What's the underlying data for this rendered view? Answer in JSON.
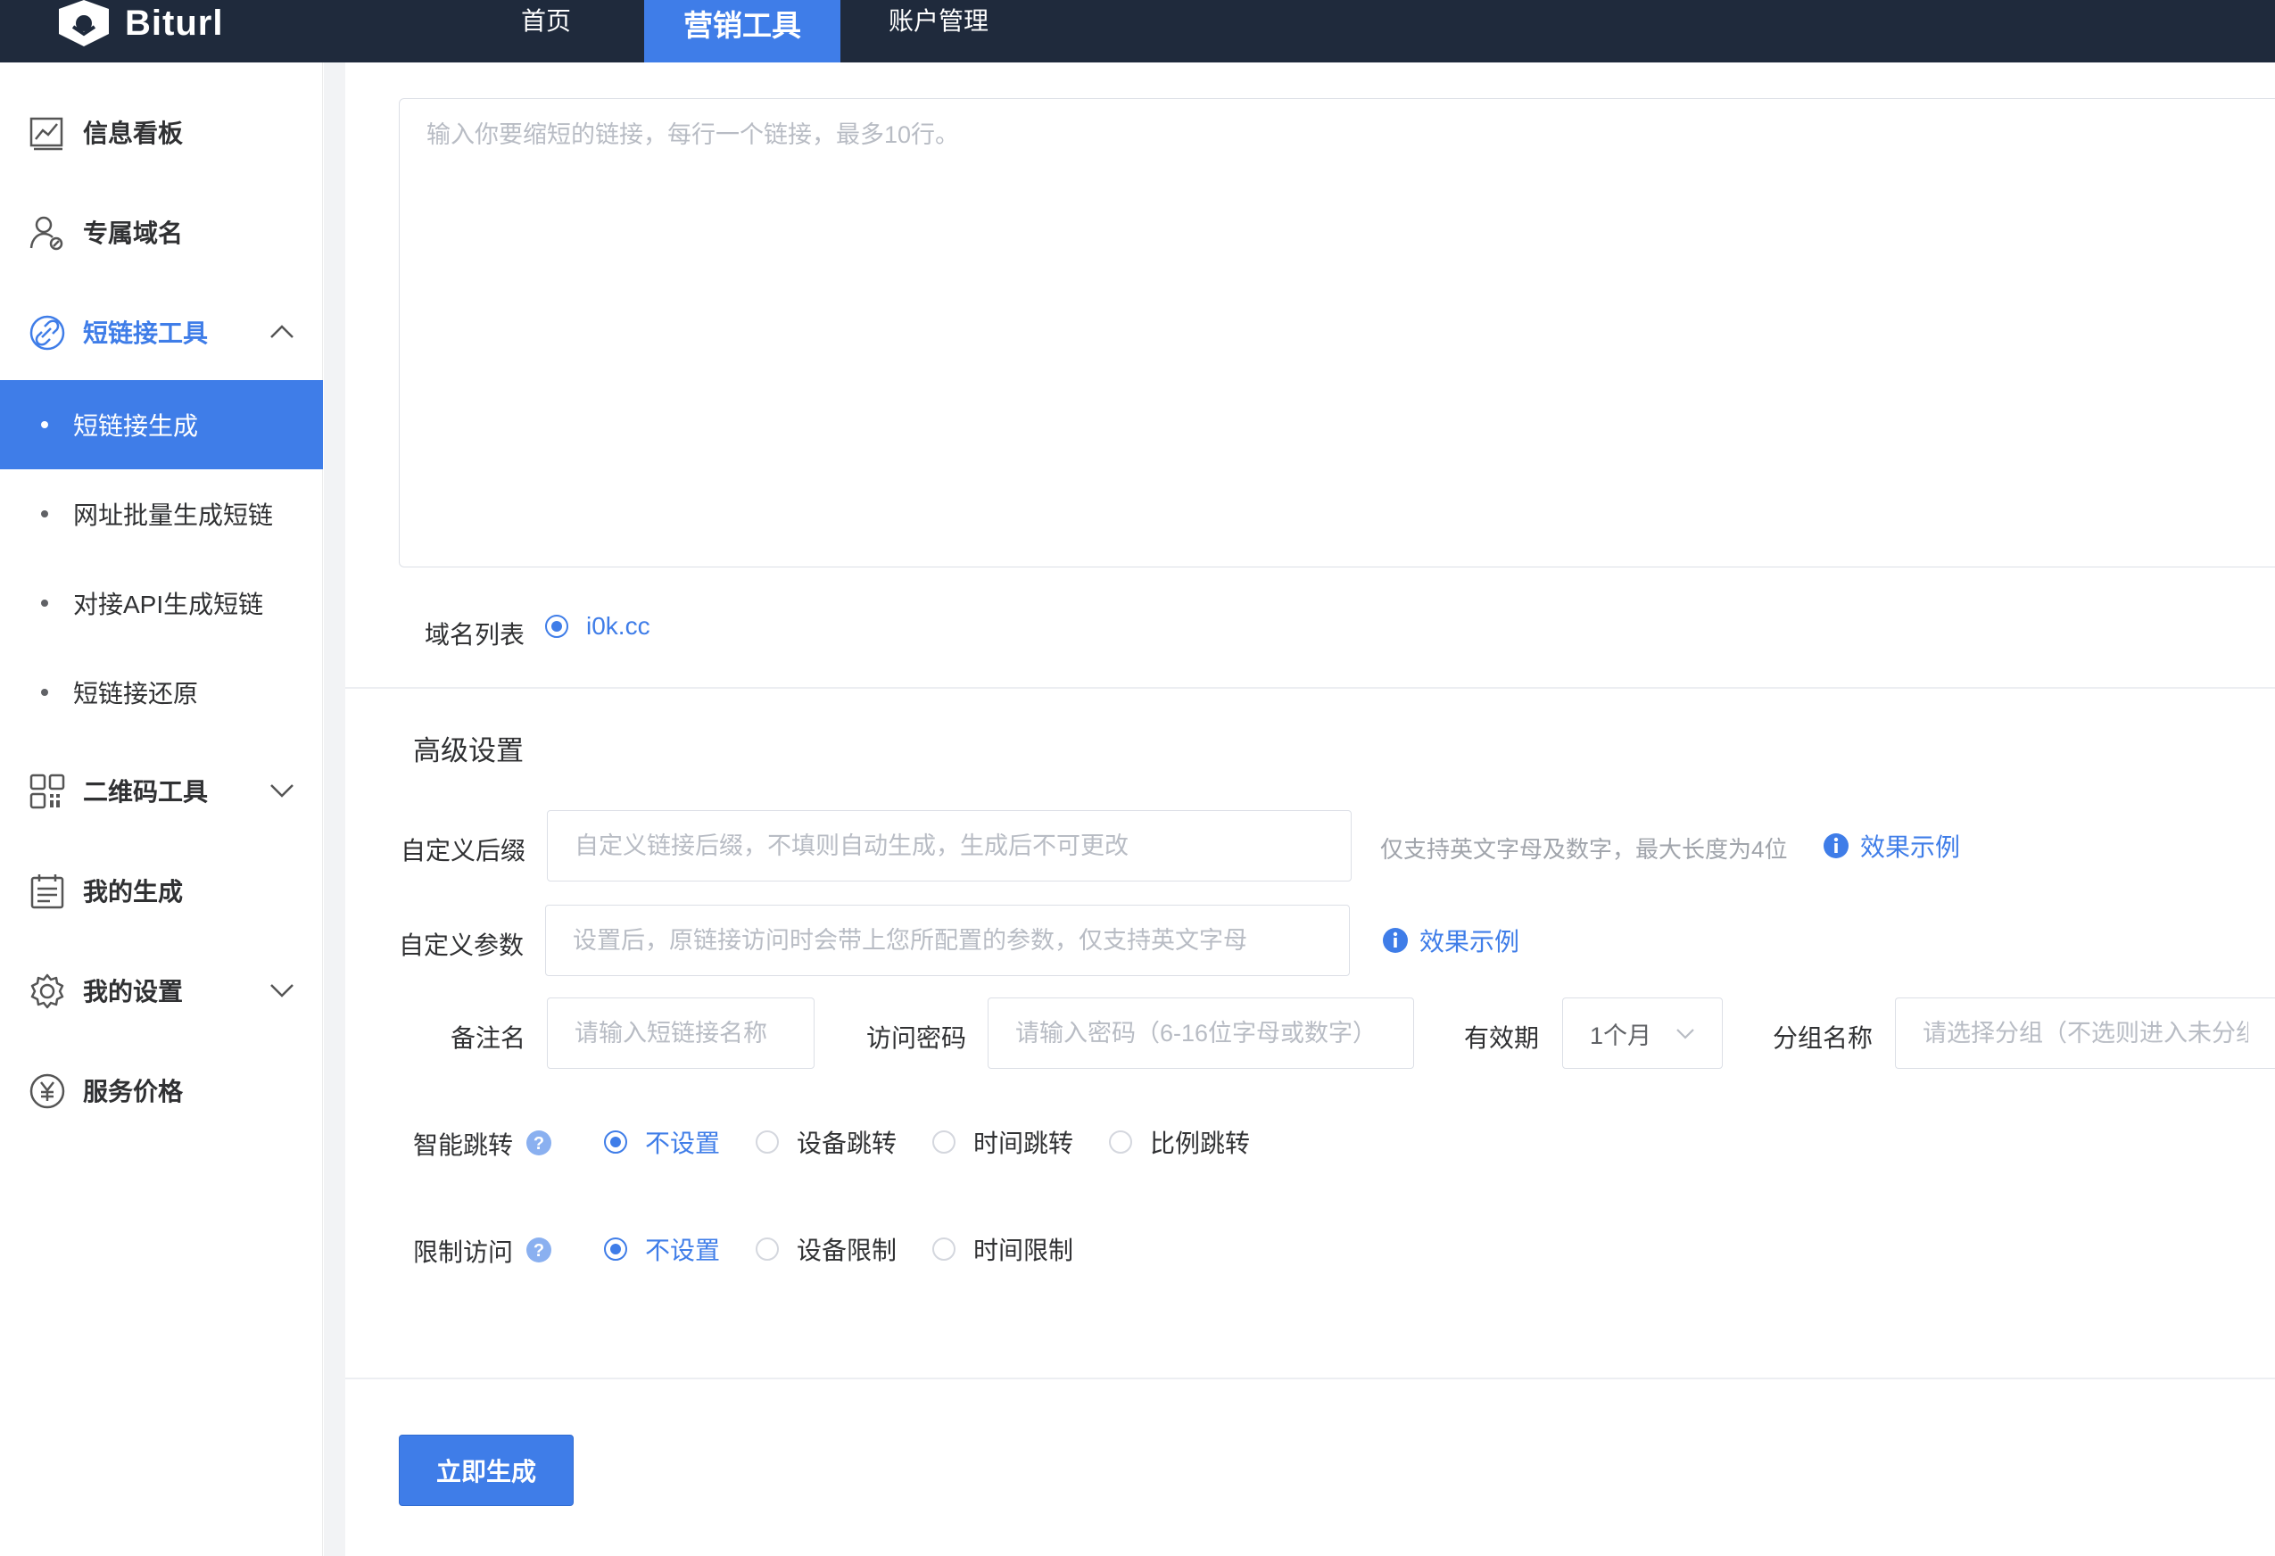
{
  "app": {
    "logo_text": "Biturl"
  },
  "topnav": {
    "home": "首页",
    "marketing_tools": "营销工具",
    "account": "账户管理"
  },
  "sidebar": {
    "dashboard": "信息看板",
    "domain": "专属域名",
    "shortlink_tools": "短链接工具",
    "sub": {
      "generate": "短链接生成",
      "batch": "网址批量生成短链",
      "api": "对接API生成短链",
      "restore": "短链接还原"
    },
    "qr_tools": "二维码工具",
    "my_generated": "我的生成",
    "my_settings": "我的设置",
    "pricing": "服务价格"
  },
  "form": {
    "url_placeholder": "输入你要缩短的链接，每行一个链接，最多10行。",
    "domain_list_label": "域名列表",
    "domain_option": "i0k.cc",
    "advanced_title": "高级设置",
    "custom_suffix_label": "自定义后缀",
    "custom_suffix_placeholder": "自定义链接后缀，不填则自动生成，生成后不可更改",
    "custom_suffix_hint": "仅支持英文字母及数字，最大长度为4位",
    "example_label": "效果示例",
    "custom_param_label": "自定义参数",
    "custom_param_placeholder": "设置后，原链接访问时会带上您所配置的参数，仅支持英文字母",
    "remark_label": "备注名",
    "remark_placeholder": "请输入短链接名称",
    "password_label": "访问密码",
    "password_placeholder": "请输入密码（6-16位字母或数字）",
    "validity_label": "有效期",
    "validity_value": "1个月",
    "group_label": "分组名称",
    "group_placeholder": "请选择分组（不选则进入未分组）",
    "smart_jump_label": "智能跳转",
    "smart_jump_options": [
      "不设置",
      "设备跳转",
      "时间跳转",
      "比例跳转"
    ],
    "restrict_label": "限制访问",
    "restrict_options": [
      "不设置",
      "设备限制",
      "时间限制"
    ],
    "submit": "立即生成"
  },
  "colors": {
    "accent": "#3f7de8",
    "topbar": "#1f2a3c"
  }
}
